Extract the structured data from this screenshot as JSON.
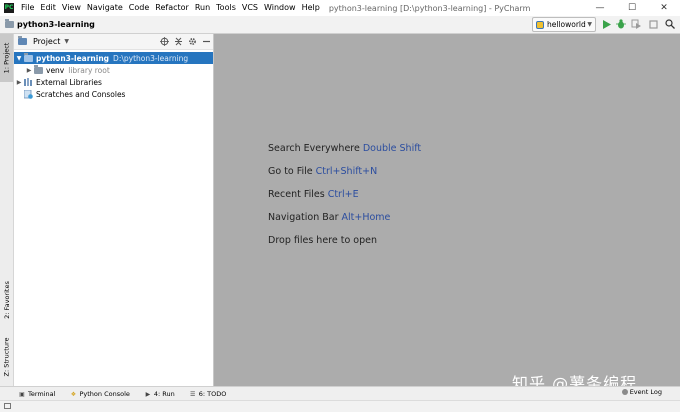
{
  "menubar": {
    "app_icon": "PC",
    "items": [
      "File",
      "Edit",
      "View",
      "Navigate",
      "Code",
      "Refactor",
      "Run",
      "Tools",
      "VCS",
      "Window",
      "Help"
    ],
    "window_title": "python3-learning [D:\\python3-learning] - PyCharm",
    "controls": [
      "—",
      "☐",
      "✕"
    ]
  },
  "navbar": {
    "breadcrumb": "python3-learning",
    "run_config": "helloworld"
  },
  "left_strip": {
    "tab_project": "1: Project",
    "tab_favorites": "2: Favorites",
    "tab_structure": "Z: Structure"
  },
  "project_panel": {
    "title": "Project",
    "tree": {
      "root_name": "python3-learning",
      "root_path": "D:\\python3-learning",
      "venv_name": "venv",
      "venv_note": "library root",
      "external_libraries": "External Libraries",
      "scratches": "Scratches and Consoles"
    }
  },
  "editor": {
    "hints": [
      {
        "text": "Search Everywhere",
        "key": "Double Shift"
      },
      {
        "text": "Go to File",
        "key": "Ctrl+Shift+N"
      },
      {
        "text": "Recent Files",
        "key": "Ctrl+E"
      },
      {
        "text": "Navigation Bar",
        "key": "Alt+Home"
      },
      {
        "text": "Drop files here to open",
        "key": ""
      }
    ]
  },
  "bottom_bar": {
    "terminal": "Terminal",
    "python_console": "Python Console",
    "run": "4: Run",
    "todo": "6: TODO",
    "event_log": "Event Log"
  },
  "watermark": "知乎 @薯条编程",
  "colors": {
    "selection": "#2675bf",
    "editor_bg": "#acacac",
    "shortcut": "#2b4d9f",
    "run_green": "#3aa34a"
  },
  "icons": {
    "run": "play-icon",
    "debug": "bug-icon",
    "search": "search-icon",
    "settings": "gear-icon"
  }
}
